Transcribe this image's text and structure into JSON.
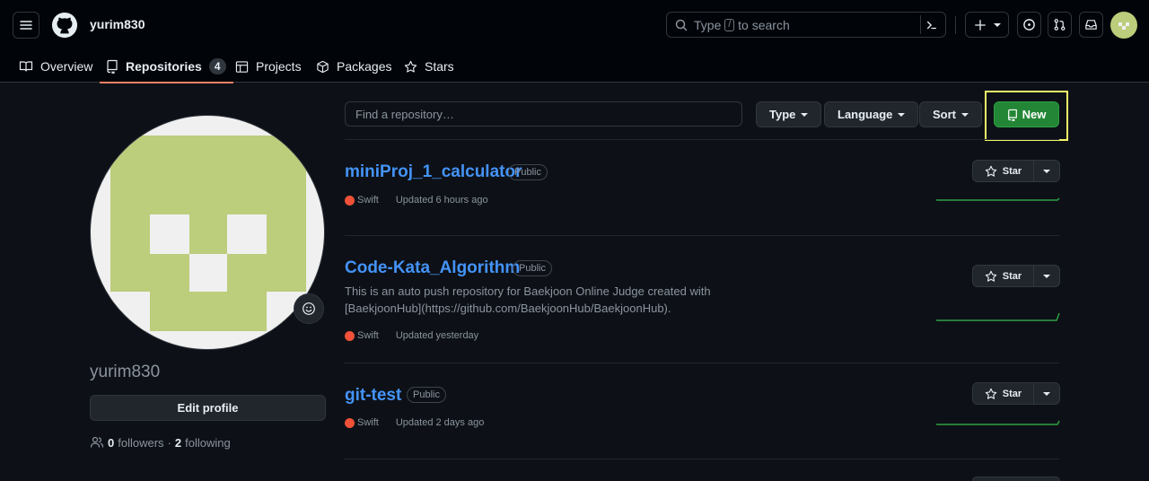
{
  "header": {
    "username": "yurim830",
    "search_prefix": "Type",
    "search_key": "/",
    "search_suffix": "to search"
  },
  "tabs": [
    {
      "label": "Overview"
    },
    {
      "label": "Repositories",
      "count": "4"
    },
    {
      "label": "Projects"
    },
    {
      "label": "Packages"
    },
    {
      "label": "Stars"
    }
  ],
  "profile": {
    "name": "yurim830",
    "edit_label": "Edit profile",
    "followers_count": "0",
    "followers_label": "followers",
    "separator": "·",
    "following_count": "2",
    "following_label": "following"
  },
  "filters": {
    "search_placeholder": "Find a repository…",
    "type_label": "Type",
    "language_label": "Language",
    "sort_label": "Sort",
    "new_label": "New"
  },
  "repos": [
    {
      "name": "miniProj_1_calculator",
      "visibility": "Public",
      "description": "",
      "language": "Swift",
      "updated": "Updated 6 hours ago",
      "star_label": "Star"
    },
    {
      "name": "Code-Kata_Algorithm",
      "visibility": "Public",
      "description": "This is an auto push repository for Baekjoon Online Judge created with [BaekjoonHub](https://github.com/BaekjoonHub/BaekjoonHub).",
      "language": "Swift",
      "updated": "Updated yesterday",
      "star_label": "Star"
    },
    {
      "name": "git-test",
      "visibility": "Public",
      "description": "",
      "language": "Swift",
      "updated": "Updated 2 days ago",
      "star_label": "Star"
    }
  ],
  "colors": {
    "accent_link": "#4493f8",
    "new_button": "#238636",
    "swift": "#f05138",
    "avatar": "#bccd7b",
    "highlight": "#f5f56a"
  }
}
